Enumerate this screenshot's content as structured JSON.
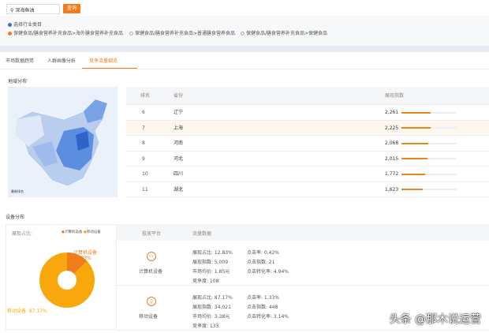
{
  "search": {
    "value": "深海鱼油",
    "button": "查询"
  },
  "filter": {
    "title": "选择行业类目",
    "options": [
      {
        "label": "保健食品/膳食营养补充食品>海外膳食营养补充食品",
        "selected": true
      },
      {
        "label": "保健食品/膳食营养补充食品>普通膳食营养食品",
        "selected": false
      },
      {
        "label": "保健食品/膳食营养补充食品>保健食品",
        "selected": false
      }
    ]
  },
  "tabs": [
    "市场数据趋势",
    "人群画像分析",
    "竞争流量细览"
  ],
  "region": {
    "title": "地域分布",
    "map_legend": "最新排名",
    "headers": [
      "排名",
      "省份",
      "展现指数"
    ],
    "rows": [
      {
        "rank": "6",
        "province": "辽宁",
        "value": "2,261",
        "pct": 0.53
      },
      {
        "rank": "7",
        "province": "上海",
        "value": "2,225",
        "pct": 0.52
      },
      {
        "rank": "8",
        "province": "河南",
        "value": "2,068",
        "pct": 0.48
      },
      {
        "rank": "9",
        "province": "河北",
        "value": "2,015",
        "pct": 0.47
      },
      {
        "rank": "10",
        "province": "四川",
        "value": "1,772",
        "pct": 0.42
      },
      {
        "rank": "11",
        "province": "湖北",
        "value": "1,623",
        "pct": 0.38
      }
    ]
  },
  "device": {
    "title": "设备分布",
    "pie_label": "展现占比:",
    "legend": [
      "计算机设备",
      "移动设备"
    ],
    "pie_pc_label": "计算机设备:",
    "pie_pc_value": "12.83%",
    "pie_mobile_label": "移动设备: 87.17%",
    "headers": [
      "投放平台",
      "流量数据"
    ],
    "colors": {
      "pc": "#f07c1b",
      "mobile": "#f8a80c"
    },
    "rows": [
      {
        "name": "计算机设备",
        "m": [
          "展现占比: 12.83%",
          "点击率: 0.42%",
          "展现指数: 5,009",
          "点击指数: 21",
          "市场均价: 1.85元",
          "点击转化率: 4.94%",
          "竞争度: 108"
        ]
      },
      {
        "name": "移动设备",
        "m": [
          "展现占比: 87.17%",
          "点击率: 1.33%",
          "展现指数: 34,021",
          "点击指数: 448",
          "市场均价: 3.38元",
          "点击转化率: 3.14%",
          "竞争度: 133"
        ]
      }
    ]
  },
  "watermark": "头条 @那木说运营"
}
